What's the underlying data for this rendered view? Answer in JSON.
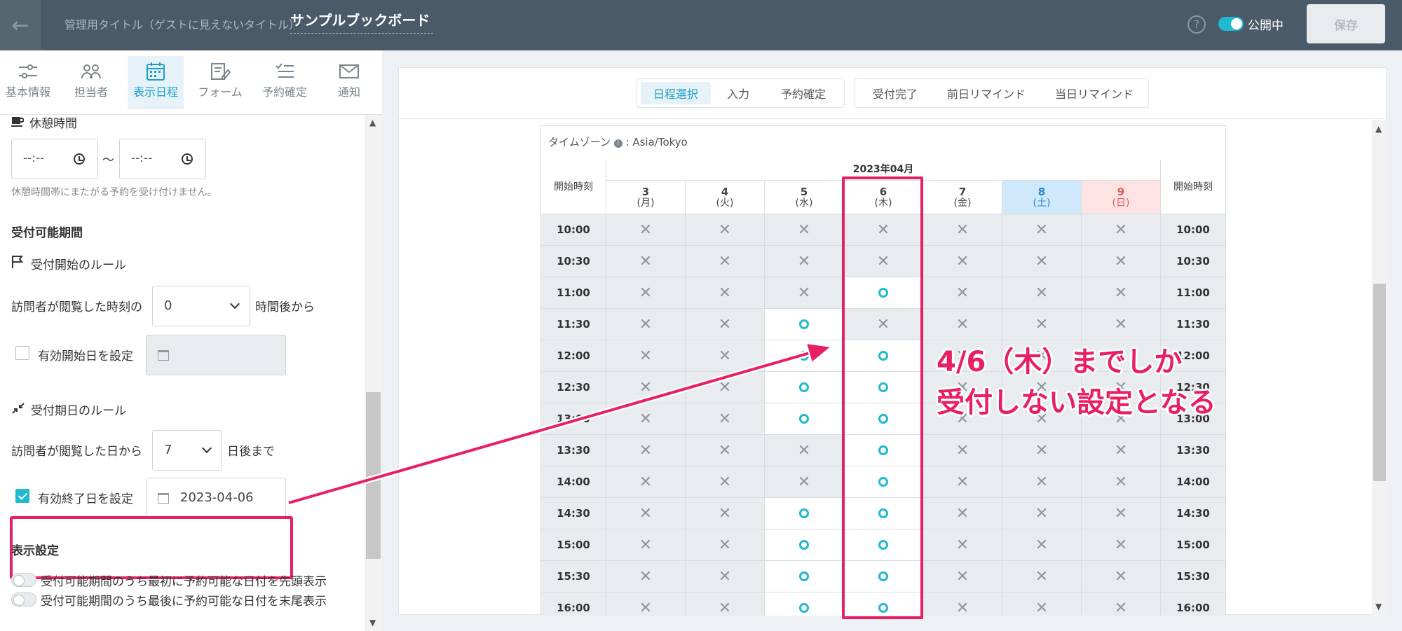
{
  "header": {
    "back_icon": "arrow-left-icon",
    "admin_label": "管理用タイトル（ゲストに見えないタイトル）",
    "title": "サンプルブックボード",
    "help": "?",
    "publish_label": "公開中",
    "save_label": "保存"
  },
  "left_tabs": [
    {
      "label": "基本情報",
      "icon": "sliders-icon"
    },
    {
      "label": "担当者",
      "icon": "users-icon"
    },
    {
      "label": "表示日程",
      "icon": "calendar-icon"
    },
    {
      "label": "フォーム",
      "icon": "form-edit-icon"
    },
    {
      "label": "予約確定",
      "icon": "list-check-icon"
    },
    {
      "label": "通知",
      "icon": "mail-icon"
    }
  ],
  "break_time": {
    "heading": "休憩時間",
    "start_value": "--:--",
    "tilde": "〜",
    "end_value": "--:--",
    "hint": "休憩時間帯にまたがる予約を受け付けません。"
  },
  "period": {
    "heading": "受付可能期間",
    "start_rule_heading": "受付開始のルール",
    "start_prefix": "訪問者が閲覧した時刻の",
    "start_hours": "0",
    "start_suffix": "時間後から",
    "start_date_label": "有効開始日を設定",
    "end_rule_heading": "受付期日のルール",
    "end_prefix": "訪問者が閲覧した日から",
    "end_days": "7",
    "end_suffix": "日後まで",
    "end_date_label": "有効終了日を設定",
    "end_date_value": "2023-04-06"
  },
  "display": {
    "heading": "表示設定",
    "option1": "受付可能期間のうち最初に予約可能な日付を先頭表示",
    "option2": "受付可能期間のうち最後に予約可能な日付を末尾表示"
  },
  "steps_group1": [
    "日程選択",
    "入力",
    "予約確定"
  ],
  "steps_group2": [
    "受付完了",
    "前日リマインド",
    "当日リマインド"
  ],
  "calendar": {
    "timezone_label": "タイムゾーン",
    "info": "i",
    "timezone_value": ": Asia/Tokyo",
    "month": "2023年04月",
    "start_label": "開始時刻",
    "days": [
      {
        "d": "3",
        "w": "(月)",
        "kind": ""
      },
      {
        "d": "4",
        "w": "(火)",
        "kind": ""
      },
      {
        "d": "5",
        "w": "(水)",
        "kind": ""
      },
      {
        "d": "6",
        "w": "(木)",
        "kind": ""
      },
      {
        "d": "7",
        "w": "(金)",
        "kind": ""
      },
      {
        "d": "8",
        "w": "(土)",
        "kind": "sat"
      },
      {
        "d": "9",
        "w": "(日)",
        "kind": "sun"
      }
    ],
    "rows": [
      {
        "t": "10:00",
        "s": "xxxxxxx"
      },
      {
        "t": "10:30",
        "s": "xxxxxxx"
      },
      {
        "t": "11:00",
        "s": "xxxoxxx"
      },
      {
        "t": "11:30",
        "s": "xxoxxxx"
      },
      {
        "t": "12:00",
        "s": "xxooxxx"
      },
      {
        "t": "12:30",
        "s": "xxooxxx"
      },
      {
        "t": "13:00",
        "s": "xxooxxx"
      },
      {
        "t": "13:30",
        "s": "xxxoxxx"
      },
      {
        "t": "14:00",
        "s": "xxxoxxx"
      },
      {
        "t": "14:30",
        "s": "xxooxxx"
      },
      {
        "t": "15:00",
        "s": "xxooxxx"
      },
      {
        "t": "15:30",
        "s": "xxooxxx"
      },
      {
        "t": "16:00",
        "s": "xxooxxx"
      }
    ]
  },
  "callout": {
    "line1": "4/6（木）までしか",
    "line2": "受付しない設定となる"
  },
  "colors": {
    "accent": "#1fb9d0",
    "highlight": "#ea1e63",
    "topbar": "#4a5a68"
  }
}
